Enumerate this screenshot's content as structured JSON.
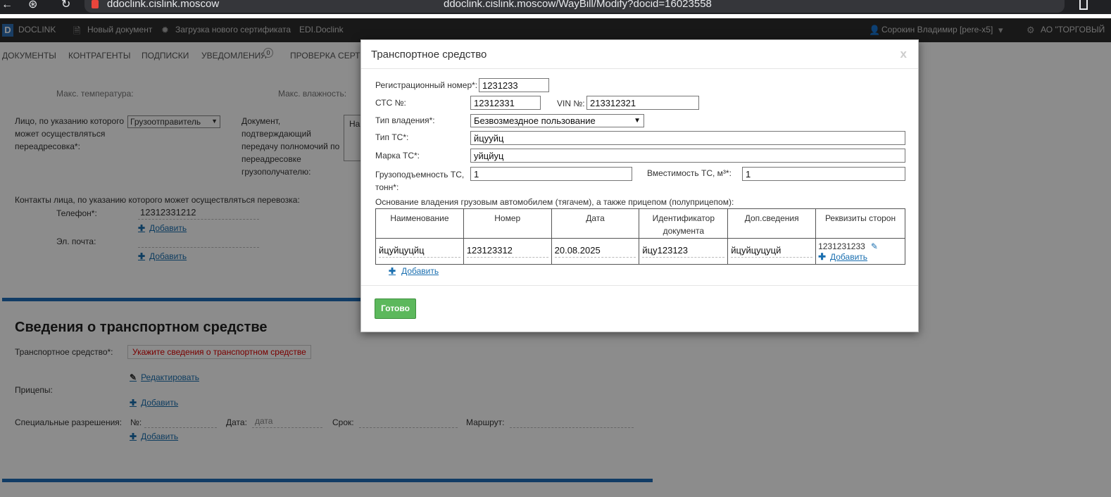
{
  "browser": {
    "host": "ddoclink.cislink.moscow",
    "url": "ddoclink.cislink.moscow/WayBill/Modify?docid=16023558"
  },
  "header": {
    "logo": "D",
    "brand": "DOCLINK",
    "new_doc": "Новый документ",
    "upload_cert": "Загрузка нового сертификата",
    "edi": "EDI.Doclink",
    "user": "Сорокин Владимир [pere-x5]",
    "org": "АО \"ТОРГОВЫЙ"
  },
  "nav": {
    "items": [
      "ДОКУМЕНТЫ",
      "КОНТРАГЕНТЫ",
      "ПОДПИСКИ",
      "УВЕДОМЛЕНИЯ",
      "ПРОВЕРКА СЕРТИ"
    ],
    "notif_count": "0"
  },
  "page": {
    "partial_top_left": "Макс. температура:",
    "partial_top_right": "Макс. влажность:",
    "redirect_label": "Лицо, по указанию которого может осуществляться переадресовка*:",
    "redirect_select": "Грузоотправитель",
    "doc_label": "Документ, подтверждающий передачу полномочий по переадресовке грузополучателю:",
    "doc_partial": "На",
    "contacts_label": "Контакты лица, по указанию которого может осуществляться перевозка:",
    "phone_label": "Телефон*:",
    "phone_value": "12312331212",
    "add": "Добавить",
    "email_label": "Эл. почта:",
    "vehicle_section_title": "Сведения о транспортном средстве",
    "vehicle_label": "Транспортное средство*:",
    "vehicle_error": "Укажите сведения о транспортном средстве",
    "edit": "Редактировать",
    "trailers_label": "Прицепы:",
    "permits_label": "Специальные разрешения:",
    "permit_no": "№:",
    "permit_date": "Дата:",
    "permit_date_placeholder": "дата",
    "permit_term": "Срок:",
    "permit_route": "Маршрут:"
  },
  "modal": {
    "title": "Транспортное средство",
    "close": "x",
    "reg_number_label": "Регистрационный номер*:",
    "reg_number": "1231233",
    "sts_label": "СТС №:",
    "sts": "12312331",
    "vin_label": "VIN №:",
    "vin": "213312321",
    "ownership_label": "Тип владения*:",
    "ownership": "Безвозмездное пользование",
    "vehicle_type_label": "Тип ТС*:",
    "vehicle_type": "йцууйц",
    "brand_label": "Марка ТС*:",
    "brand": "уйцйуц",
    "capacity_label": "Грузоподъемность ТС, тонн*:",
    "capacity": "1",
    "volume_label": "Вместимость ТС, м³*:",
    "volume": "1",
    "basis_label": "Основание владения грузовым автомобилем (тягачем), а также прицепом (полуприцепом):",
    "table": {
      "headers": [
        "Наименование",
        "Номер",
        "Дата",
        "Идентификатор документа",
        "Доп.сведения",
        "Реквизиты сторон"
      ],
      "row": [
        "йцуйцуцйц",
        "123123312",
        "20.08.2025",
        "йцу123123",
        "йцуйцуцуцй"
      ],
      "requisites": "1231231233"
    },
    "add": "Добавить",
    "ok_button": "Готово"
  }
}
